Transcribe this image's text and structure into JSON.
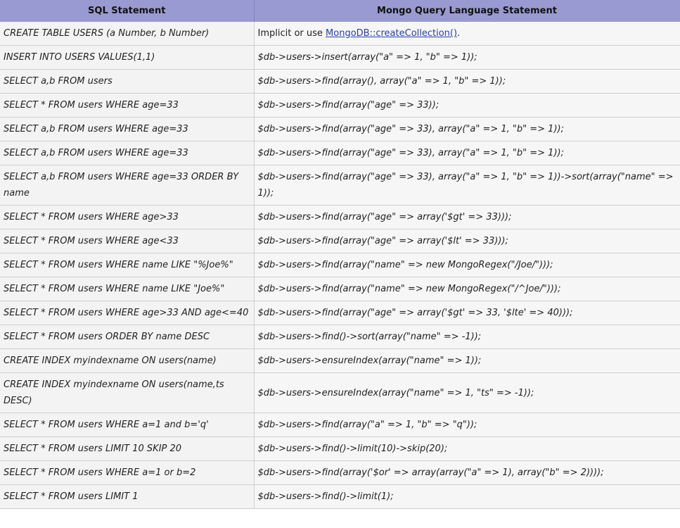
{
  "header": {
    "sql": "SQL Statement",
    "mongo": "Mongo Query Language Statement"
  },
  "rows": [
    {
      "sql": "CREATE TABLE USERS (a Number, b Number)",
      "mongo_prefix": "Implicit or use ",
      "mongo_link": "MongoDB::createCollection()",
      "mongo_suffix": "."
    },
    {
      "sql": "INSERT INTO USERS VALUES(1,1)",
      "mongo": "$db->users->insert(array(\"a\" => 1, \"b\" => 1));"
    },
    {
      "sql": "SELECT a,b FROM users",
      "mongo": "$db->users->find(array(), array(\"a\" => 1, \"b\" => 1));"
    },
    {
      "sql": "SELECT * FROM users WHERE age=33",
      "mongo": "$db->users->find(array(\"age\" => 33));"
    },
    {
      "sql": "SELECT a,b FROM users WHERE age=33",
      "mongo": "$db->users->find(array(\"age\" => 33), array(\"a\" => 1, \"b\" => 1));"
    },
    {
      "sql": "SELECT a,b FROM users WHERE age=33",
      "mongo": "$db->users->find(array(\"age\" => 33), array(\"a\" => 1, \"b\" => 1));"
    },
    {
      "sql": "SELECT a,b FROM users WHERE age=33 ORDER BY name",
      "mongo": "$db->users->find(array(\"age\" => 33), array(\"a\" => 1, \"b\" => 1))->sort(array(\"name\" => 1));"
    },
    {
      "sql": "SELECT * FROM users WHERE age>33",
      "mongo": "$db->users->find(array(\"age\" => array('$gt' => 33)));"
    },
    {
      "sql": "SELECT * FROM users WHERE age<33",
      "mongo": "$db->users->find(array(\"age\" => array('$lt' => 33)));"
    },
    {
      "sql": "SELECT * FROM users WHERE name LIKE \"%Joe%\"",
      "mongo": "$db->users->find(array(\"name\" => new MongoRegex(\"/Joe/\")));"
    },
    {
      "sql": "SELECT * FROM users WHERE name LIKE \"Joe%\"",
      "mongo": "$db->users->find(array(\"name\" => new MongoRegex(\"/^Joe/\")));"
    },
    {
      "sql": "SELECT * FROM users WHERE age>33 AND age<=40",
      "mongo": "$db->users->find(array(\"age\" => array('$gt' => 33, '$lte' => 40)));"
    },
    {
      "sql": "SELECT * FROM users ORDER BY name DESC",
      "mongo": "$db->users->find()->sort(array(\"name\" => -1));"
    },
    {
      "sql": "CREATE INDEX myindexname ON users(name)",
      "mongo": "$db->users->ensureIndex(array(\"name\" => 1));"
    },
    {
      "sql": "CREATE INDEX myindexname ON users(name,ts DESC)",
      "mongo": "$db->users->ensureIndex(array(\"name\" => 1, \"ts\" => -1));"
    },
    {
      "sql": "SELECT * FROM users WHERE a=1 and b='q'",
      "mongo": "$db->users->find(array(\"a\" => 1, \"b\" => \"q\"));"
    },
    {
      "sql": "SELECT * FROM users LIMIT 10 SKIP 20",
      "mongo": "$db->users->find()->limit(10)->skip(20);"
    },
    {
      "sql": "SELECT * FROM users WHERE a=1 or b=2",
      "mongo": "$db->users->find(array('$or' => array(array(\"a\" => 1), array(\"b\" => 2))));"
    },
    {
      "sql": "SELECT * FROM users LIMIT 1",
      "mongo": "$db->users->find()->limit(1);"
    }
  ]
}
